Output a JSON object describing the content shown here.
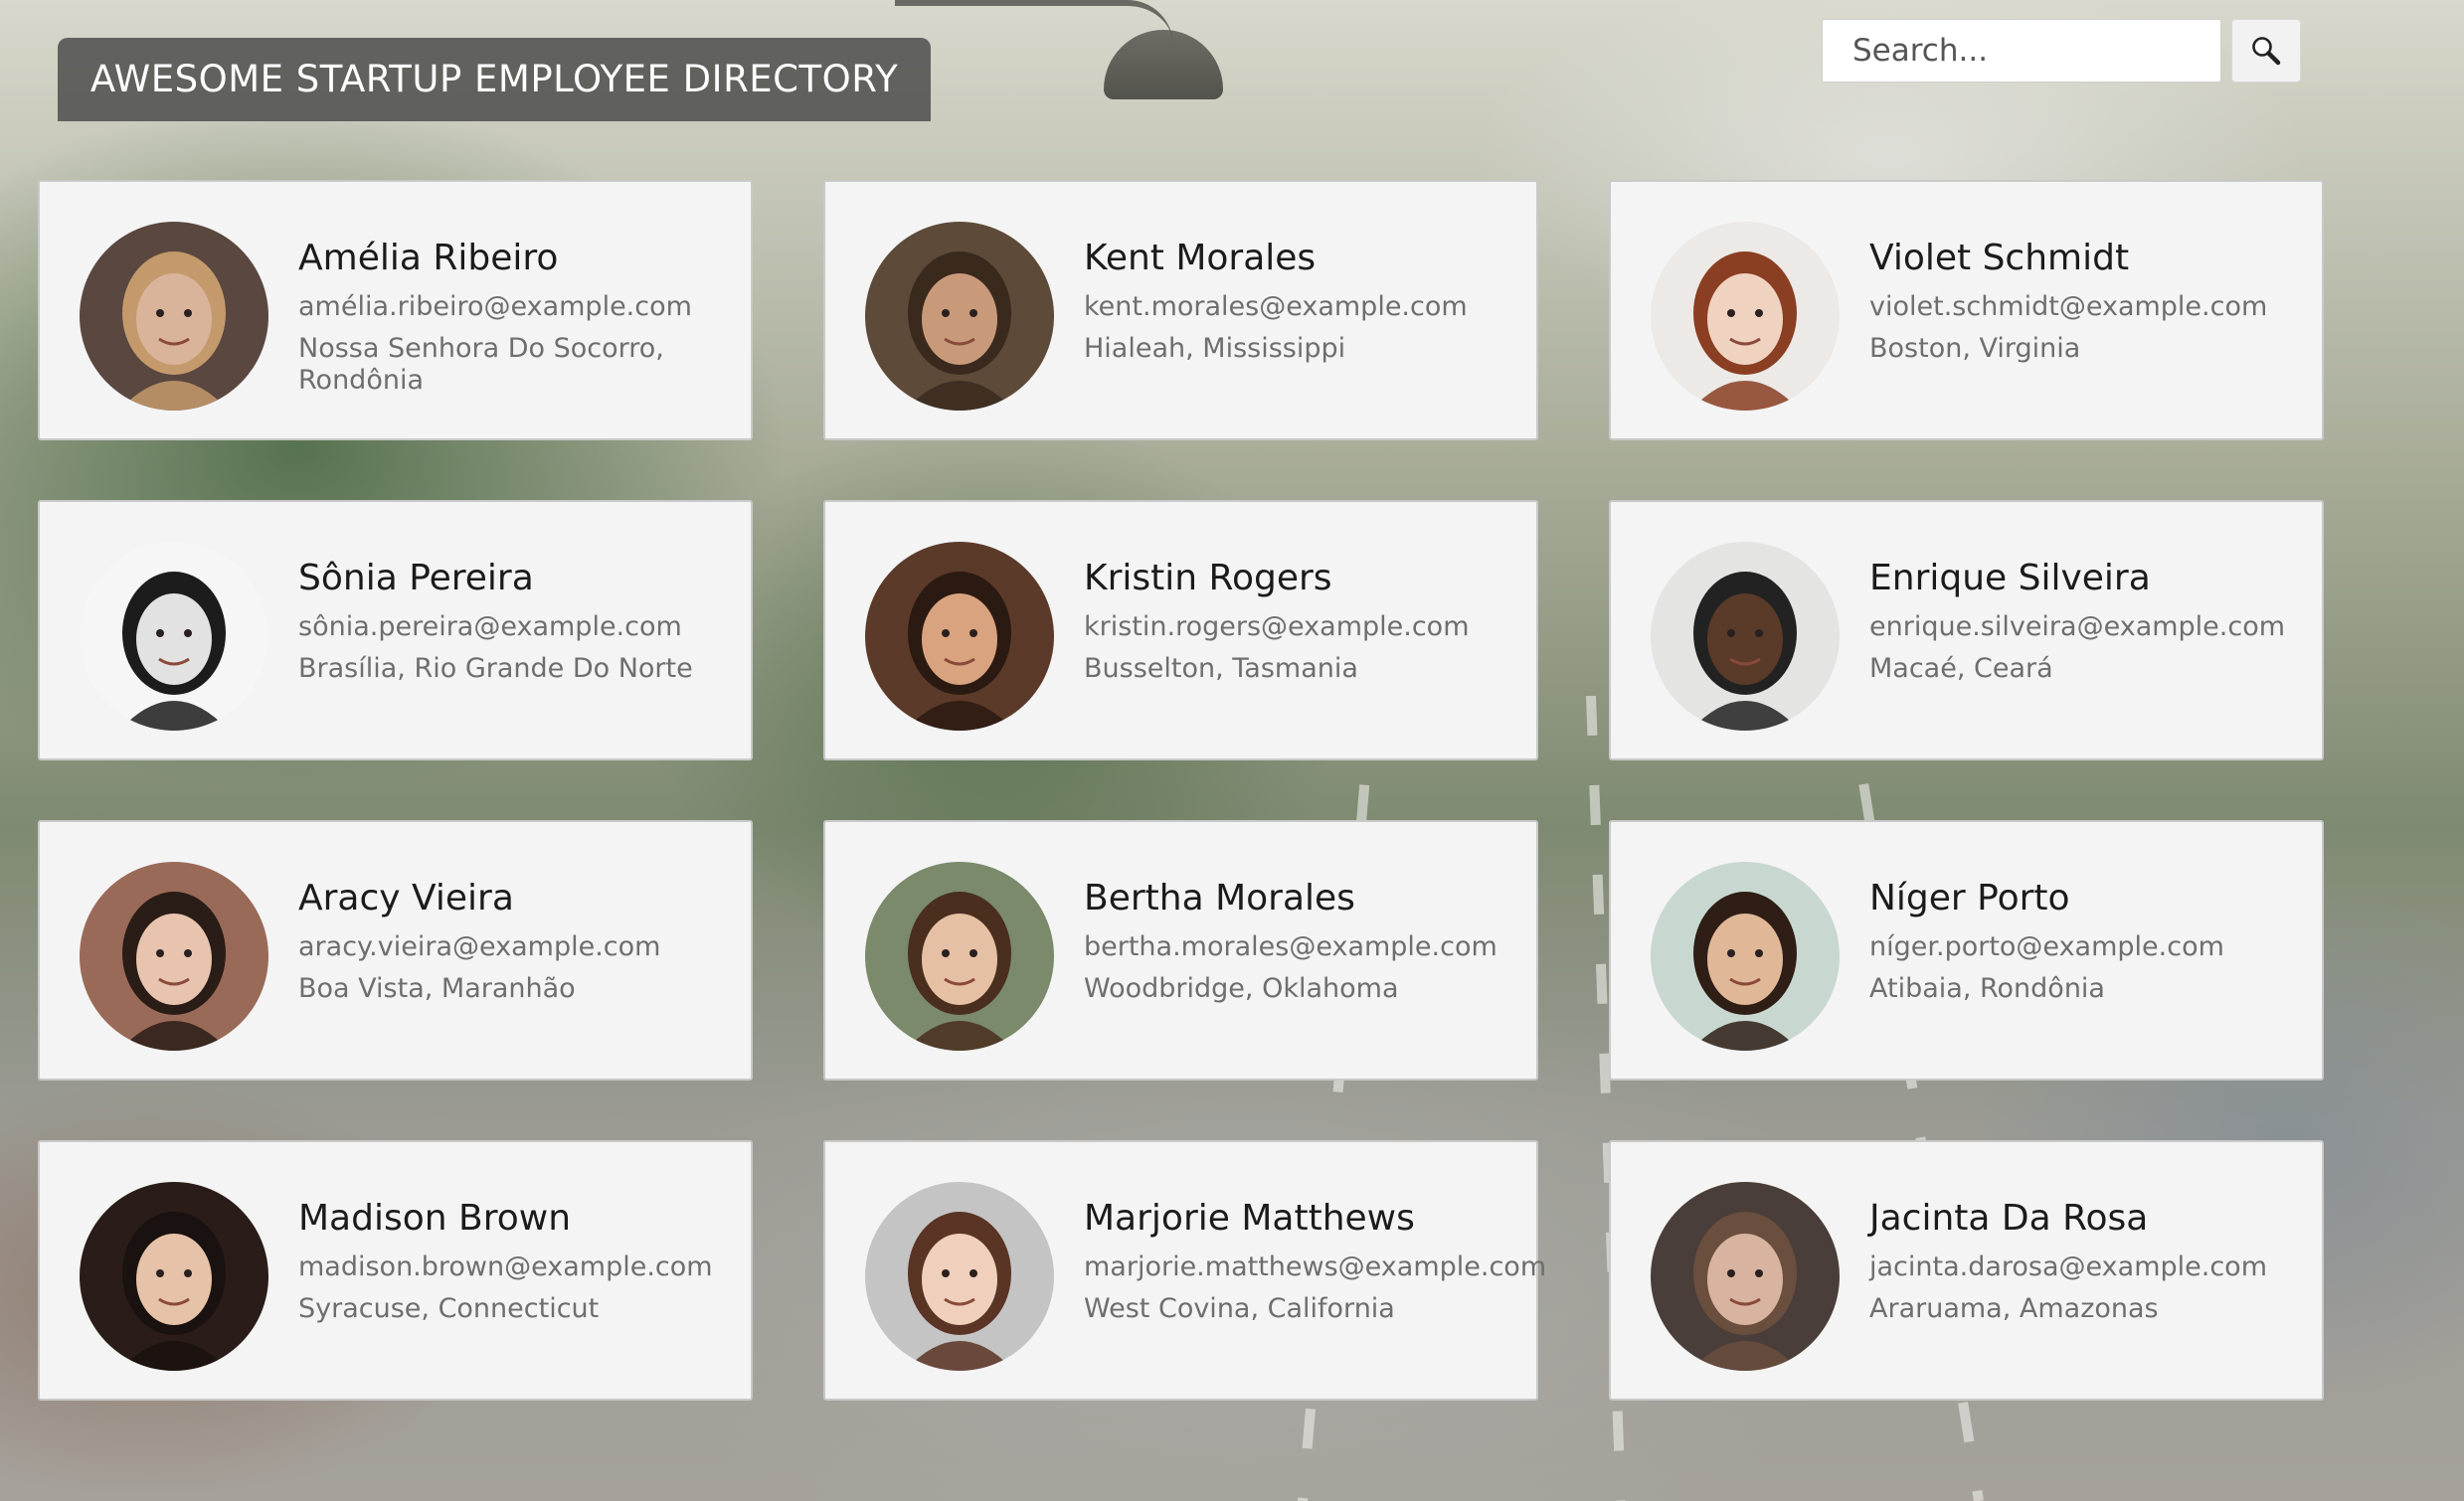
{
  "header": {
    "title": "AWESOME STARTUP EMPLOYEE DIRECTORY"
  },
  "search": {
    "placeholder": "Search...",
    "button_icon": "search-icon"
  },
  "employees": [
    {
      "name": "Amélia Ribeiro",
      "email": "amélia.ribeiro@example.com",
      "location": "Nossa Senhora Do Socorro, Rondônia",
      "avatar_bg": "#5a4740",
      "avatar_face": "#d9b39a",
      "avatar_hair": "#c49a6c"
    },
    {
      "name": "Kent Morales",
      "email": "kent.morales@example.com",
      "location": "Hialeah, Mississippi",
      "avatar_bg": "#5d4a38",
      "avatar_face": "#c99a7a",
      "avatar_hair": "#3a2a1e"
    },
    {
      "name": "Violet Schmidt",
      "email": "violet.schmidt@example.com",
      "location": "Boston, Virginia",
      "avatar_bg": "#ece9e6",
      "avatar_face": "#f0d2c0",
      "avatar_hair": "#8a3e22"
    },
    {
      "name": "Sônia Pereira",
      "email": "sônia.pereira@example.com",
      "location": "Brasília, Rio Grande Do Norte",
      "avatar_bg": "#f6f6f6",
      "avatar_face": "#e2e2e2",
      "avatar_hair": "#1c1c1c"
    },
    {
      "name": "Kristin Rogers",
      "email": "kristin.rogers@example.com",
      "location": "Busselton, Tasmania",
      "avatar_bg": "#5c3a2a",
      "avatar_face": "#d8a37e",
      "avatar_hair": "#2a1a12"
    },
    {
      "name": "Enrique Silveira",
      "email": "enrique.silveira@example.com",
      "location": "Macaé, Ceará",
      "avatar_bg": "#e4e4e2",
      "avatar_face": "#5a3a28",
      "avatar_hair": "#222222"
    },
    {
      "name": "Aracy Vieira",
      "email": "aracy.vieira@example.com",
      "location": "Boa Vista, Maranhão",
      "avatar_bg": "#9a6a58",
      "avatar_face": "#e8c4ae",
      "avatar_hair": "#2a1c16"
    },
    {
      "name": "Bertha Morales",
      "email": "bertha.morales@example.com",
      "location": "Woodbridge, Oklahoma",
      "avatar_bg": "#7a8a6a",
      "avatar_face": "#e6c0a4",
      "avatar_hair": "#4a2e1e"
    },
    {
      "name": "Níger Porto",
      "email": "níger.porto@example.com",
      "location": "Atibaia, Rondônia",
      "avatar_bg": "#c8d8d0",
      "avatar_face": "#e0b898",
      "avatar_hair": "#2e1e16"
    },
    {
      "name": "Madison Brown",
      "email": "madison.brown@example.com",
      "location": "Syracuse, Connecticut",
      "avatar_bg": "#2a1c18",
      "avatar_face": "#e6c2a8",
      "avatar_hair": "#1a1210"
    },
    {
      "name": "Marjorie Matthews",
      "email": "marjorie.matthews@example.com",
      "location": "West Covina, California",
      "avatar_bg": "#c4c4c4",
      "avatar_face": "#f0d0bc",
      "avatar_hair": "#5a3424"
    },
    {
      "name": "Jacinta Da Rosa",
      "email": "jacinta.darosa@example.com",
      "location": "Araruama, Amazonas",
      "avatar_bg": "#4a3e3a",
      "avatar_face": "#d8b4a0",
      "avatar_hair": "#6a4e3e"
    }
  ]
}
